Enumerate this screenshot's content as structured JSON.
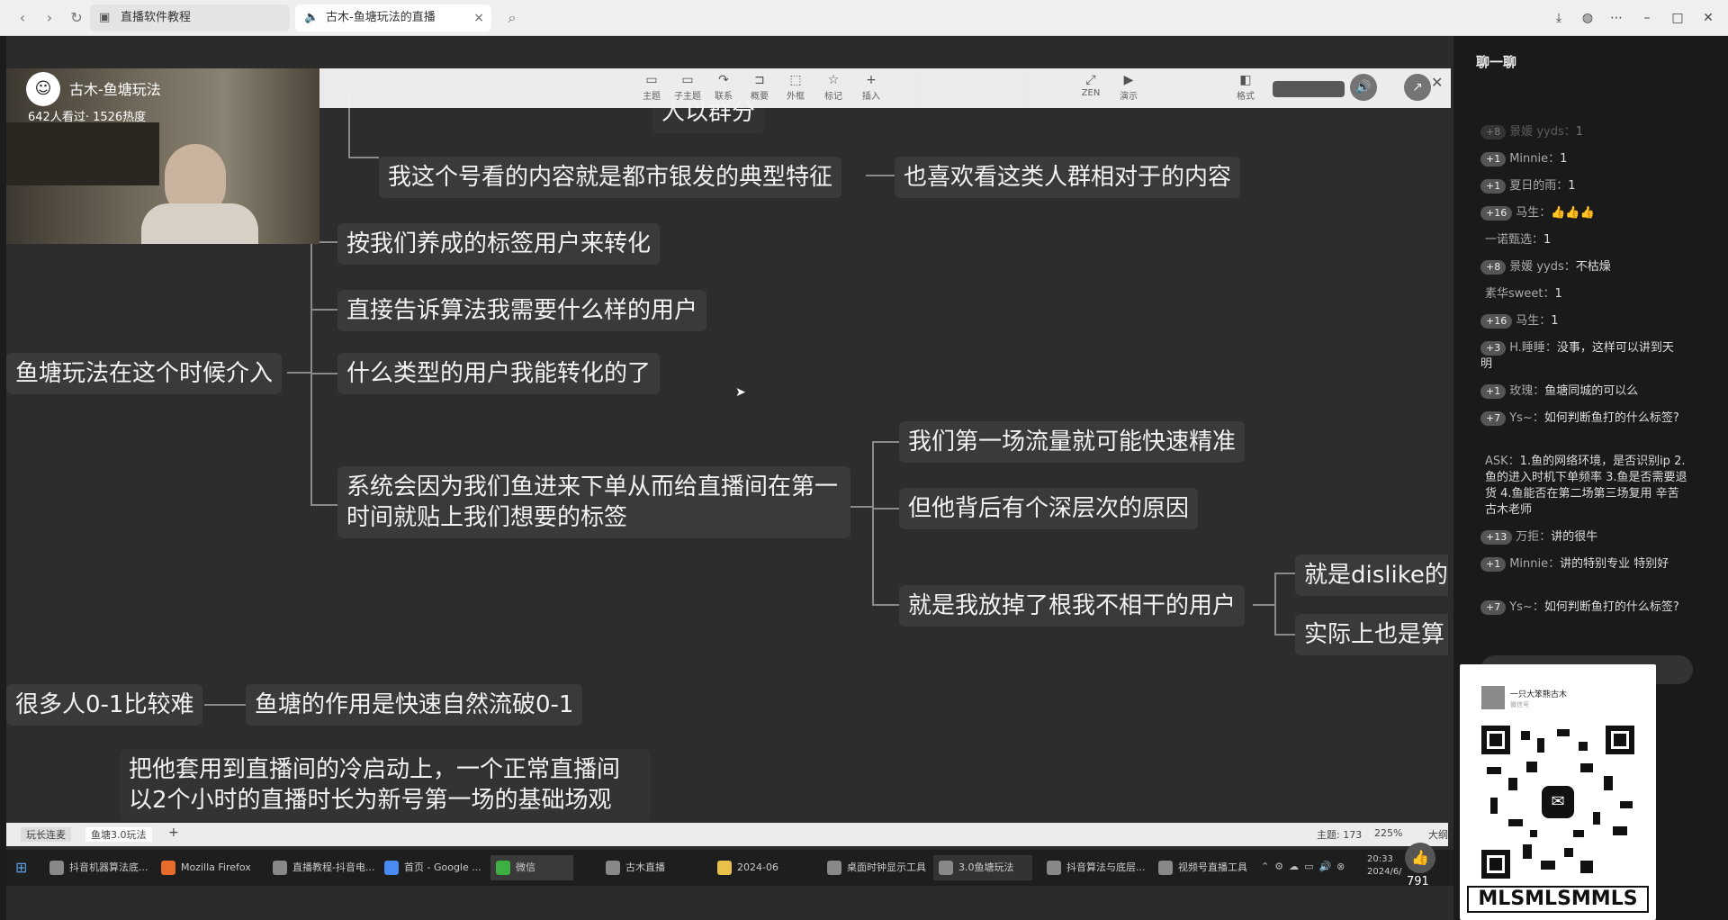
{
  "browser": {
    "tabs": [
      {
        "label": "直播软件教程",
        "icon": "tab-icon"
      },
      {
        "label": "古木-鱼塘玩法的直播",
        "icon": "speaker-icon"
      }
    ]
  },
  "streamer": {
    "name": "古木-鱼塘玩法",
    "stats": "642人看过· 1526热度"
  },
  "toolbar": {
    "items": [
      {
        "label": "主题",
        "icon": "palette-icon"
      },
      {
        "label": "子主题",
        "icon": "subtopic-icon"
      },
      {
        "label": "联系",
        "icon": "link-icon"
      },
      {
        "label": "概要",
        "icon": "summary-icon"
      },
      {
        "label": "外框",
        "icon": "frame-icon"
      },
      {
        "label": "标记",
        "icon": "star-icon"
      },
      {
        "label": "插入",
        "icon": "plus-icon"
      },
      {
        "label": "ZEN",
        "icon": "expand-icon"
      },
      {
        "label": "演示",
        "icon": "present-icon"
      },
      {
        "label": "格式",
        "icon": "format-icon"
      }
    ]
  },
  "mindmap": {
    "top_partial": "人以群分",
    "n1": "我这个号看的内容就是都市银发的典型特征",
    "n2": "也喜欢看这类人群相对于的内容",
    "root": "鱼塘玩法在这个时候介入",
    "b1": "按我们养成的标签用户来转化",
    "b2": "直接告诉算法我需要什么样的用户",
    "b3": "什么类型的用户我能转化的了",
    "b4": "系统会因为我们鱼进来下单从而给直播间在第一时间就贴上我们想要的标签",
    "c1": "我们第一场流量就可能快速精准",
    "c2": "但他背后有个深层次的原因",
    "c3": "就是我放掉了根我不相干的用户",
    "d1": "就是dislike的内",
    "d2": "实际上也是算",
    "e1": "很多人0-1比较难",
    "e2": "鱼塘的作用是快速自然流破0-1",
    "f1": "把他套用到直播间的冷启动上，一个正常直播间以2个小时的直播时长为新号第一场的基础场观"
  },
  "sheetbar": {
    "tabs": [
      "玩长连麦",
      "鱼塘3.0玩法"
    ],
    "add": "+",
    "topic_count": "主题: 173",
    "zoom": "225%",
    "fit": "大纲"
  },
  "taskbar": {
    "items": [
      "抖音机器算法底...",
      "Mozilla Firefox",
      "直播教程-抖音电...",
      "首页 - Google ...",
      "微信",
      "古木直播",
      "2024-06",
      "桌面时钟显示工具",
      "3.0鱼塘玩法",
      "抖音算法与底层...",
      "视频号直播工具"
    ],
    "time": "20:33",
    "date": "2024/6/",
    "likes": "791"
  },
  "chat": {
    "title": "聊一聊",
    "messages": [
      {
        "badge": "8",
        "user": "景媛 yyds：",
        "text": "1"
      },
      {
        "badge": "1",
        "user": "Minnie：",
        "text": "1"
      },
      {
        "badge": "1",
        "user": "夏日的雨：",
        "text": "1"
      },
      {
        "badge": "16",
        "user": "马生：",
        "text": "👍👍👍"
      },
      {
        "badge": "",
        "user": "一诺甄选：",
        "text": "1"
      },
      {
        "badge": "8",
        "user": "景媛 yyds：",
        "text": "不枯燥"
      },
      {
        "badge": "",
        "user": "素华sweet：",
        "text": "1"
      },
      {
        "badge": "16",
        "user": "马生：",
        "text": "1"
      },
      {
        "badge": "3",
        "user": "H.睡睡：",
        "text": "没事，这样可以讲到天明"
      },
      {
        "badge": "1",
        "user": "玫瑰：",
        "text": "鱼塘同城的可以么"
      },
      {
        "badge": "7",
        "user": "Ys~：",
        "text": "如何判断鱼打的什么标签?"
      },
      {
        "badge": "",
        "user": "ASK：",
        "text": "1.鱼的网络环境，是否识别ip 2.鱼的进入时机下单频率 3.鱼是否需要退货 4.鱼能否在第二场第三场复用 辛苦古木老师"
      },
      {
        "badge": "13",
        "user": "万拒：",
        "text": "讲的很牛"
      },
      {
        "badge": "1",
        "user": "Minnie：",
        "text": "讲的特别专业 特别好"
      },
      {
        "badge": "7",
        "user": "Ys~：",
        "text": "如何判断鱼打的什么标签?"
      }
    ]
  },
  "qr": {
    "name": "一只大笨熊古木",
    "sub": "微信号",
    "caption": "MLSMLSMMLS"
  }
}
